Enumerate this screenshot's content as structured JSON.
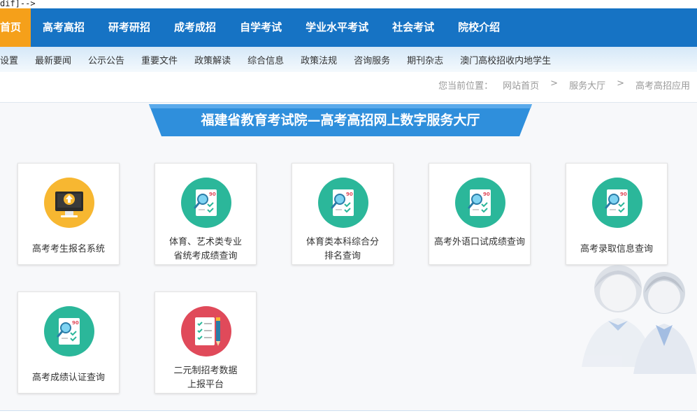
{
  "top_comment": "dif]-->",
  "main_nav": {
    "items": [
      "首页",
      "高考高招",
      "研考研招",
      "成考成招",
      "自学考试",
      "学业水平考试",
      "社会考试",
      "院校介绍"
    ]
  },
  "sub_nav": {
    "items": [
      "设置",
      "最新要闻",
      "公示公告",
      "重要文件",
      "政策解读",
      "综合信息",
      "政策法规",
      "咨询服务",
      "期刊杂志",
      "澳门高校招收内地学生"
    ]
  },
  "breadcrumb": {
    "label": "您当前位置：",
    "links": [
      "网站首页",
      "服务大厅",
      "高考高招应用"
    ],
    "separator": ">"
  },
  "banner": {
    "title": "福建省教育考试院—高考高招网上数字服务大厅"
  },
  "services": [
    {
      "icon": "monitor-upload-icon",
      "lines": [
        "高考考生报名系统"
      ]
    },
    {
      "icon": "score-query-icon",
      "lines": [
        "体育、艺术类专业",
        "省统考成绩查询"
      ]
    },
    {
      "icon": "score-query-icon",
      "lines": [
        "体育类本科综合分",
        "排名查询"
      ]
    },
    {
      "icon": "score-query-icon",
      "lines": [
        "高考外语口试成绩查询"
      ]
    },
    {
      "icon": "score-query-icon",
      "lines": [
        "高考录取信息查询"
      ]
    },
    {
      "icon": "score-query-icon",
      "lines": [
        "高考成绩认证查询"
      ]
    },
    {
      "icon": "checklist-pencil-icon",
      "lines": [
        "二元制招考数据",
        "上报平台"
      ]
    }
  ],
  "score_badge": "90",
  "colors": {
    "nav_blue": "#1673c4",
    "nav_active": "#f5a01a",
    "banner_blue": "#2f8fdc",
    "icon_green": "#2bb79a",
    "icon_yellow": "#f7b731",
    "icon_red": "#e04a5a"
  }
}
